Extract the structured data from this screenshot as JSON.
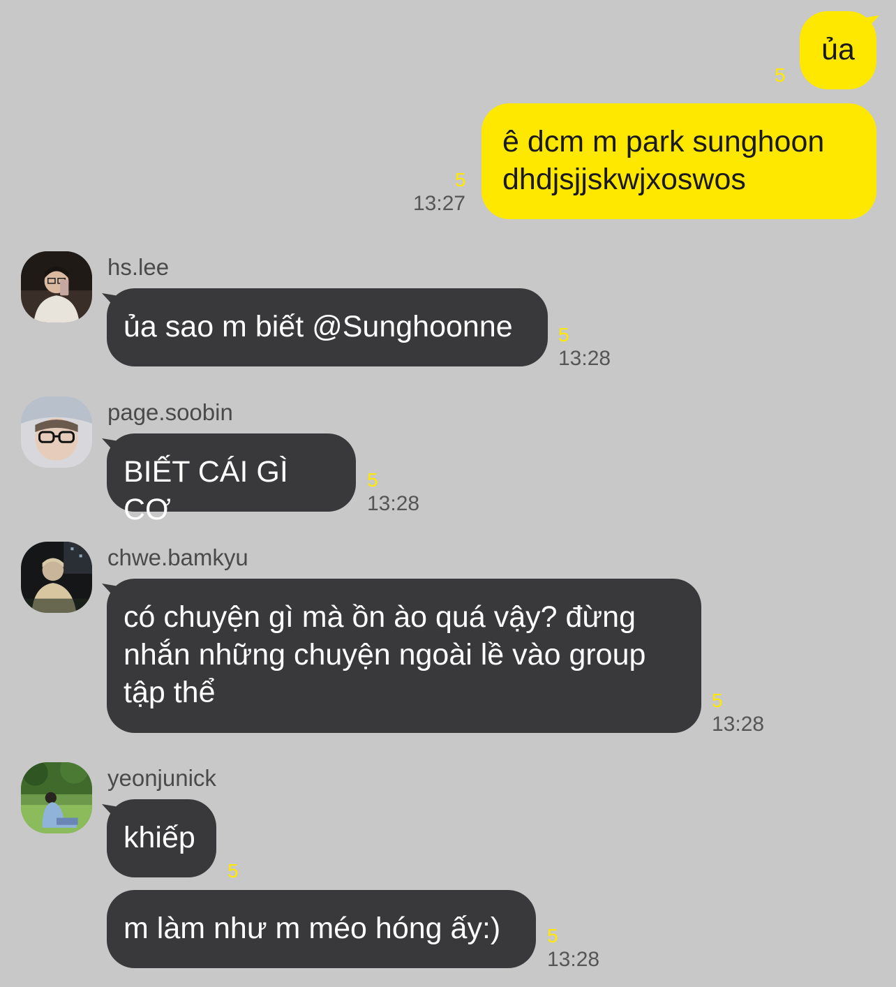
{
  "messages": {
    "out1": {
      "text": "ủa",
      "unread": "5"
    },
    "out2": {
      "text": "ê dcm m park sunghoon\ndhdjsjjskwjxoswos",
      "unread": "5",
      "time": "13:27"
    },
    "hs": {
      "name": "hs.lee",
      "text": "ủa sao m biết @Sunghoonne",
      "unread": "5",
      "time": "13:28"
    },
    "soobin": {
      "name": "page.soobin",
      "text": "BIẾT CÁI GÌ CƠ",
      "unread": "5",
      "time": "13:28"
    },
    "bamkyu": {
      "name": "chwe.bamkyu",
      "text": "có chuyện gì mà ồn ào quá vậy? đừng\nnhắn những chuyện ngoài lề vào group\ntập thể",
      "unread": "5",
      "time": "13:28"
    },
    "yeonjun": {
      "name": "yeonjunick",
      "text1": "khiếp",
      "unread1": "5",
      "text2": "m làm như m méo hóng ấy:)",
      "unread2": "5",
      "time2": "13:28"
    }
  },
  "icons": {
    "avatar_hs": "avatar-photo-mirror-selfie",
    "avatar_soobin": "avatar-photo-glasses",
    "avatar_bamkyu": "avatar-photo-night",
    "avatar_yeonjun": "avatar-photo-park"
  },
  "colors": {
    "background": "#c8c8c8",
    "outgoing_bubble": "#ffe800",
    "incoming_bubble": "#39393b",
    "unread_count": "#ffe800"
  }
}
